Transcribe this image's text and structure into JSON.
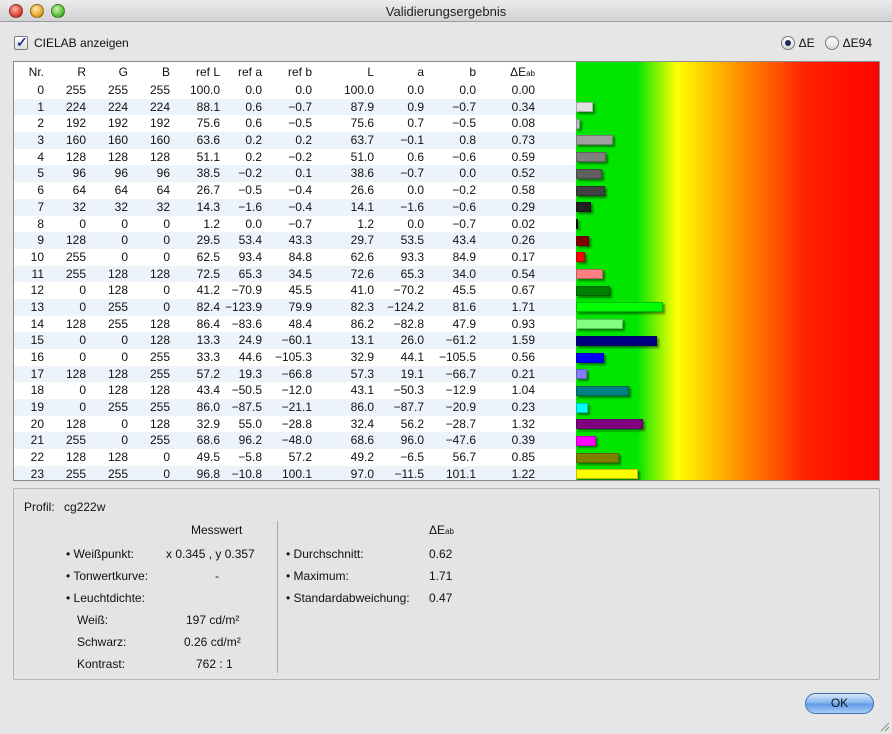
{
  "window": {
    "title": "Validierungsergebnis"
  },
  "options": {
    "show_cielab_label": "CIELAB anzeigen",
    "show_cielab_checked": true,
    "radio_de_label": "ΔE",
    "radio_de94_label": "ΔE94",
    "selected": "ΔE"
  },
  "table": {
    "headers": [
      "Nr.",
      "R",
      "G",
      "B",
      "ref L",
      "ref a",
      "ref b",
      "L",
      "a",
      "b",
      "ΔE"
    ],
    "de_subscript": "ab",
    "rows": [
      [
        "0",
        "255",
        "255",
        "255",
        "100.0",
        "0.0",
        "0.0",
        "100.0",
        "0.0",
        "0.0",
        "0.00"
      ],
      [
        "1",
        "224",
        "224",
        "224",
        "88.1",
        "0.6",
        "−0.7",
        "87.9",
        "0.9",
        "−0.7",
        "0.34"
      ],
      [
        "2",
        "192",
        "192",
        "192",
        "75.6",
        "0.6",
        "−0.5",
        "75.6",
        "0.7",
        "−0.5",
        "0.08"
      ],
      [
        "3",
        "160",
        "160",
        "160",
        "63.6",
        "0.2",
        "0.2",
        "63.7",
        "−0.1",
        "0.8",
        "0.73"
      ],
      [
        "4",
        "128",
        "128",
        "128",
        "51.1",
        "0.2",
        "−0.2",
        "51.0",
        "0.6",
        "−0.6",
        "0.59"
      ],
      [
        "5",
        "96",
        "96",
        "96",
        "38.5",
        "−0.2",
        "0.1",
        "38.6",
        "−0.7",
        "0.0",
        "0.52"
      ],
      [
        "6",
        "64",
        "64",
        "64",
        "26.7",
        "−0.5",
        "−0.4",
        "26.6",
        "0.0",
        "−0.2",
        "0.58"
      ],
      [
        "7",
        "32",
        "32",
        "32",
        "14.3",
        "−1.6",
        "−0.4",
        "14.1",
        "−1.6",
        "−0.6",
        "0.29"
      ],
      [
        "8",
        "0",
        "0",
        "0",
        "1.2",
        "0.0",
        "−0.7",
        "1.2",
        "0.0",
        "−0.7",
        "0.02"
      ],
      [
        "9",
        "128",
        "0",
        "0",
        "29.5",
        "53.4",
        "43.3",
        "29.7",
        "53.5",
        "43.4",
        "0.26"
      ],
      [
        "10",
        "255",
        "0",
        "0",
        "62.5",
        "93.4",
        "84.8",
        "62.6",
        "93.3",
        "84.9",
        "0.17"
      ],
      [
        "11",
        "255",
        "128",
        "128",
        "72.5",
        "65.3",
        "34.5",
        "72.6",
        "65.3",
        "34.0",
        "0.54"
      ],
      [
        "12",
        "0",
        "128",
        "0",
        "41.2",
        "−70.9",
        "45.5",
        "41.0",
        "−70.2",
        "45.5",
        "0.67"
      ],
      [
        "13",
        "0",
        "255",
        "0",
        "82.4",
        "−123.9",
        "79.9",
        "82.3",
        "−124.2",
        "81.6",
        "1.71"
      ],
      [
        "14",
        "128",
        "255",
        "128",
        "86.4",
        "−83.6",
        "48.4",
        "86.2",
        "−82.8",
        "47.9",
        "0.93"
      ],
      [
        "15",
        "0",
        "0",
        "128",
        "13.3",
        "24.9",
        "−60.1",
        "13.1",
        "26.0",
        "−61.2",
        "1.59"
      ],
      [
        "16",
        "0",
        "0",
        "255",
        "33.3",
        "44.6",
        "−105.3",
        "32.9",
        "44.1",
        "−105.5",
        "0.56"
      ],
      [
        "17",
        "128",
        "128",
        "255",
        "57.2",
        "19.3",
        "−66.8",
        "57.3",
        "19.1",
        "−66.7",
        "0.21"
      ],
      [
        "18",
        "0",
        "128",
        "128",
        "43.4",
        "−50.5",
        "−12.0",
        "43.1",
        "−50.3",
        "−12.9",
        "1.04"
      ],
      [
        "19",
        "0",
        "255",
        "255",
        "86.0",
        "−87.5",
        "−21.1",
        "86.0",
        "−87.7",
        "−20.9",
        "0.23"
      ],
      [
        "20",
        "128",
        "0",
        "128",
        "32.9",
        "55.0",
        "−28.8",
        "32.4",
        "56.2",
        "−28.7",
        "1.32"
      ],
      [
        "21",
        "255",
        "0",
        "255",
        "68.6",
        "96.2",
        "−48.0",
        "68.6",
        "96.0",
        "−47.6",
        "0.39"
      ],
      [
        "22",
        "128",
        "128",
        "0",
        "49.5",
        "−5.8",
        "57.2",
        "49.2",
        "−6.5",
        "56.7",
        "0.85"
      ],
      [
        "23",
        "255",
        "255",
        "0",
        "96.8",
        "−10.8",
        "100.1",
        "97.0",
        "−11.5",
        "101.1",
        "1.22"
      ]
    ]
  },
  "bars": {
    "scale_max_de": 6.0,
    "colors": [
      "#ffffff",
      "#e0e0e0",
      "#c0c0c0",
      "#a0a0a0",
      "#808080",
      "#606060",
      "#404040",
      "#202020",
      "#000000",
      "#800000",
      "#ff0000",
      "#ff8080",
      "#008000",
      "#00ff00",
      "#80ff80",
      "#000080",
      "#0000ff",
      "#8080ff",
      "#008080",
      "#00ffff",
      "#800080",
      "#ff00ff",
      "#808000",
      "#ffff00"
    ]
  },
  "summary": {
    "profile_label": "Profil:",
    "profile_value": "cg222w",
    "measured_heading": "Messwert",
    "whitepoint_label": "Weißpunkt:",
    "whitepoint_value": "x 0.345 , y 0.357",
    "tone_curve_label": "Tonwertkurve:",
    "tone_curve_value": "-",
    "luminance_label": "Leuchtdichte:",
    "white_label": "Weiß:",
    "white_value": "197 cd/m²",
    "black_label": "Schwarz:",
    "black_value": "0.26 cd/m²",
    "contrast_label": "Kontrast:",
    "contrast_value": "762 : 1",
    "de_heading": "ΔE",
    "de_heading_sub": "ab",
    "average_label": "Durchschnitt:",
    "average_value": "0.62",
    "maximum_label": "Maximum:",
    "maximum_value": "1.71",
    "stddev_label": "Standardabweichung:",
    "stddev_value": "0.47"
  },
  "buttons": {
    "ok_label": "OK"
  }
}
